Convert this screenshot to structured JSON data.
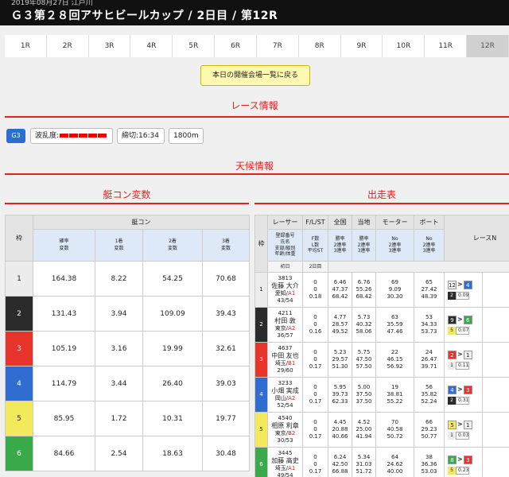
{
  "header": {
    "date_line": "2019年08月27日 江戸川",
    "title": "Ｇ３第２８回アサヒビールカップ / 2日目 / 第12R"
  },
  "race_tabs": [
    "1R",
    "2R",
    "3R",
    "4R",
    "5R",
    "6R",
    "7R",
    "8R",
    "9R",
    "10R",
    "11R",
    "12R"
  ],
  "active_tab": "12R",
  "back_button": "本日の開催会場一覧に戻る",
  "race_info": {
    "section_title": "レース情報",
    "grade": "G3",
    "wave_label": "波乱度:",
    "deadline": "締切:16:34",
    "distance": "1800m"
  },
  "weather": {
    "section_title": "天候情報"
  },
  "boat_section_title": "艇コン変数",
  "entry_section_title": "出走表",
  "left_table": {
    "waku_header": "枠",
    "group_header": "艇コン",
    "col_headers": [
      [
        "確率",
        "変数"
      ],
      [
        "1着",
        "変数"
      ],
      [
        "2着",
        "変数"
      ],
      [
        "3着",
        "変数"
      ]
    ],
    "rows": [
      {
        "waku": "1",
        "v": [
          "164.38",
          "8.22",
          "54.25",
          "70.68"
        ]
      },
      {
        "waku": "2",
        "v": [
          "131.43",
          "3.94",
          "109.09",
          "39.43"
        ]
      },
      {
        "waku": "3",
        "v": [
          "105.19",
          "3.16",
          "19.99",
          "32.61"
        ]
      },
      {
        "waku": "4",
        "v": [
          "114.79",
          "3.44",
          "26.40",
          "39.03"
        ]
      },
      {
        "waku": "5",
        "v": [
          "85.95",
          "1.72",
          "10.31",
          "19.77"
        ]
      },
      {
        "waku": "6",
        "v": [
          "84.66",
          "2.54",
          "18.63",
          "30.48"
        ]
      }
    ]
  },
  "right_table": {
    "waku_header": "枠",
    "headers": [
      "レーサー",
      "F/L/ST",
      "全国",
      "当地",
      "モーター",
      "ボート",
      "レースN"
    ],
    "sub_headers": {
      "racer": [
        "登録番号",
        "氏名",
        "支部/級別",
        "年齢/体重"
      ],
      "flst": [
        "F数",
        "L数",
        "平均ST"
      ],
      "national": [
        "勝率",
        "2連率",
        "3連率"
      ],
      "local": [
        "勝率",
        "2連率",
        "3連率"
      ],
      "motor": [
        "No",
        "2連率",
        "3連率"
      ],
      "boat": [
        "No",
        "2連率",
        "3連率"
      ],
      "day1": "初日",
      "day2": "2日目"
    },
    "rows": [
      {
        "waku": "1",
        "reg": "3813",
        "name": "佐藤 大介",
        "branch": "愛知/",
        "class": "A1",
        "age": "43/54",
        "f": "0",
        "l": "0",
        "st": "0.18",
        "nat": [
          "6.46",
          "47.37",
          "68.42"
        ],
        "loc": [
          "6.76",
          "55.26",
          "68.42"
        ],
        "motor": [
          "69",
          "9.09",
          "30.30"
        ],
        "boat": [
          "65",
          "27.42",
          "48.39"
        ],
        "res": {
          "a": "12",
          "b": "4",
          "c": "2",
          "stv": "0.09"
        }
      },
      {
        "waku": "2",
        "reg": "4211",
        "name": "村田 敦",
        "branch": "東京/",
        "class": "A2",
        "age": "36/57",
        "f": "0",
        "l": "0",
        "st": "0.16",
        "nat": [
          "4.77",
          "28.57",
          "49.52"
        ],
        "loc": [
          "5.73",
          "40.32",
          "58.06"
        ],
        "motor": [
          "63",
          "35.59",
          "47.46"
        ],
        "boat": [
          "53",
          "34.33",
          "53.73"
        ],
        "res": {
          "a": "9",
          "b": "6",
          "c": "5",
          "stv": "0.07"
        }
      },
      {
        "waku": "3",
        "reg": "4637",
        "name": "中田 友也",
        "branch": "埼玉/",
        "class": "B1",
        "age": "29/60",
        "f": "0",
        "l": "0",
        "st": "0.17",
        "nat": [
          "5.23",
          "29.57",
          "51.30"
        ],
        "loc": [
          "5.75",
          "47.50",
          "57.50"
        ],
        "motor": [
          "22",
          "46.15",
          "56.92"
        ],
        "boat": [
          "24",
          "26.47",
          "39.71"
        ],
        "res": {
          "a": "2",
          "b": "1",
          "c": "1",
          "stv": "0.11"
        }
      },
      {
        "waku": "4",
        "reg": "3233",
        "name": "小畑 実成",
        "branch": "岡山/",
        "class": "A2",
        "age": "52/54",
        "f": "0",
        "l": "0",
        "st": "0.17",
        "nat": [
          "5.95",
          "39.73",
          "62.33"
        ],
        "loc": [
          "5.00",
          "37.50",
          "37.50"
        ],
        "motor": [
          "19",
          "38.81",
          "55.22"
        ],
        "boat": [
          "56",
          "35.82",
          "52.24"
        ],
        "res": {
          "a": "4",
          "b": "3",
          "c": "2",
          "stv": "0.31"
        }
      },
      {
        "waku": "5",
        "reg": "4540",
        "name": "相原 利章",
        "branch": "東京/",
        "class": "B2",
        "age": "30/53",
        "f": "0",
        "l": "0",
        "st": "0.17",
        "nat": [
          "4.45",
          "20.88",
          "40.66"
        ],
        "loc": [
          "4.52",
          "25.00",
          "41.94"
        ],
        "motor": [
          "70",
          "40.58",
          "50.72"
        ],
        "boat": [
          "66",
          "29.23",
          "50.77"
        ],
        "res": {
          "a": "5",
          "b": "1",
          "c": "1",
          "stv": "0.03"
        }
      },
      {
        "waku": "6",
        "reg": "3445",
        "name": "加藤 高史",
        "branch": "埼玉/",
        "class": "A1",
        "age": "49/54",
        "f": "0",
        "l": "0",
        "st": "0.17",
        "nat": [
          "6.24",
          "42.50",
          "66.88"
        ],
        "loc": [
          "5.34",
          "31.03",
          "51.72"
        ],
        "motor": [
          "64",
          "24.62",
          "40.00"
        ],
        "boat": [
          "38",
          "36.36",
          "53.03"
        ],
        "res": {
          "a": "8",
          "b": "3",
          "c": "5",
          "stv": "0.23"
        }
      }
    ]
  },
  "colors": {
    "accent_red": "#dd2222",
    "grade_blue": "#2a6fd0",
    "waku": [
      "#ececec",
      "#2b2b2b",
      "#e8352b",
      "#2f6ed0",
      "#f2ea5a",
      "#3aa94a"
    ]
  }
}
